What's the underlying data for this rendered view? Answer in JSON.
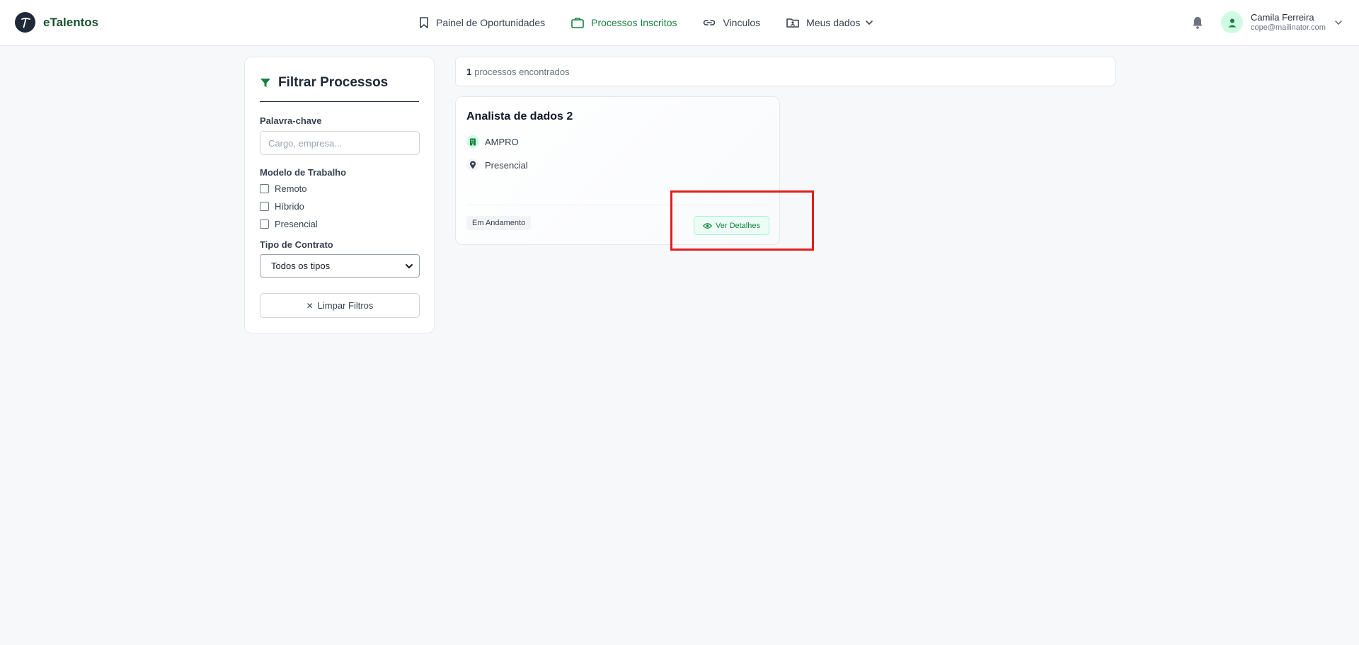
{
  "app": {
    "name": "eTalentos"
  },
  "nav": {
    "items": [
      {
        "label": "Painel de Oportunidades",
        "icon": "bookmark-icon",
        "active": false
      },
      {
        "label": "Processos Inscritos",
        "icon": "briefcase-icon",
        "active": true
      },
      {
        "label": "Vinculos",
        "icon": "link-icon",
        "active": false
      },
      {
        "label": "Meus dados",
        "icon": "id-card-icon",
        "active": false
      }
    ]
  },
  "user": {
    "name": "Camila Ferreira",
    "email": "cope@mailinator.com"
  },
  "filters": {
    "title": "Filtrar Processos",
    "keyword_label": "Palavra-chave",
    "keyword_placeholder": "Cargo, empresa...",
    "keyword_value": "",
    "model_label": "Modelo de Trabalho",
    "models": [
      {
        "label": "Remoto",
        "checked": false
      },
      {
        "label": "Híbrido",
        "checked": false
      },
      {
        "label": "Presencial",
        "checked": false
      }
    ],
    "contract_label": "Tipo de Contrato",
    "contract_selected": "Todos os tipos",
    "clear_label": "Limpar Filtros"
  },
  "results": {
    "count": "1",
    "count_text": "processos encontrados",
    "cards": [
      {
        "title": "Analista de dados 2",
        "company": "AMPRO",
        "work_model": "Presencial",
        "status": "Em Andamento",
        "details_label": "Ver Detalhes"
      }
    ]
  },
  "colors": {
    "brand": "#14532d",
    "accent": "#15803d",
    "highlight": "#e11d1d"
  }
}
